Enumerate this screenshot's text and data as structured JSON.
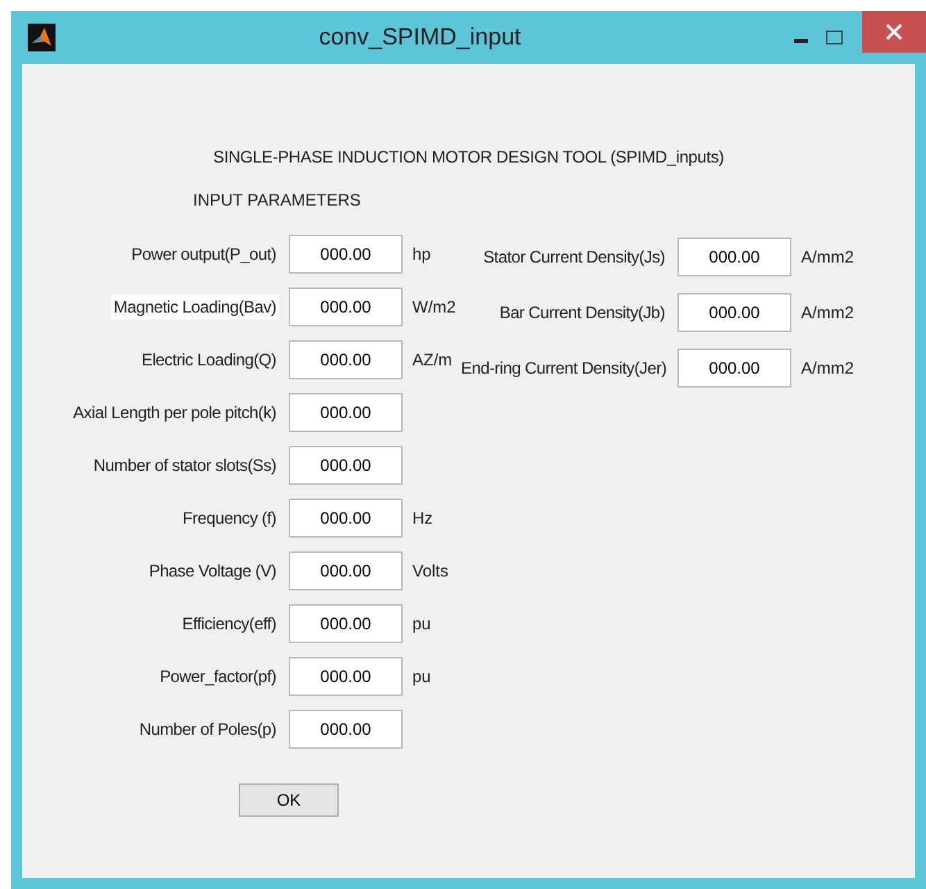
{
  "window": {
    "title": "conv_SPIMD_input"
  },
  "heading": "SINGLE-PHASE INDUCTION MOTOR DESIGN TOOL (SPIMD_inputs)",
  "section_label": "INPUT PARAMETERS",
  "left_fields": [
    {
      "label": "Power output(P_out)",
      "value": "000.00",
      "unit": "hp",
      "highlighted": false
    },
    {
      "label": "Magnetic Loading(Bav)",
      "value": "000.00",
      "unit": "W/m2",
      "highlighted": true
    },
    {
      "label": "Electric Loading(Q)",
      "value": "000.00",
      "unit": "AZ/m",
      "highlighted": false
    },
    {
      "label": "Axial Length per pole pitch(k)",
      "value": "000.00",
      "highlighted": false
    },
    {
      "label": "Number of stator slots(Ss)",
      "value": "000.00",
      "highlighted": false
    },
    {
      "label": "Frequency (f)",
      "value": "000.00",
      "unit": "Hz",
      "highlighted": false
    },
    {
      "label": "Phase Voltage (V)",
      "value": "000.00",
      "unit": "Volts",
      "highlighted": false
    },
    {
      "label": "Efficiency(eff)",
      "value": "000.00",
      "unit": "pu",
      "highlighted": false
    },
    {
      "label": "Power_factor(pf)",
      "value": "000.00",
      "unit": "pu",
      "highlighted": false
    },
    {
      "label": "Number of Poles(p)",
      "value": "000.00",
      "highlighted": false
    }
  ],
  "right_fields": [
    {
      "label": "Stator Current Density(Js)",
      "value": "000.00",
      "unit": "A/mm2"
    },
    {
      "label": "Bar Current Density(Jb)",
      "value": "000.00",
      "unit": "A/mm2"
    },
    {
      "label": "End-ring Current Density(Jer)",
      "value": "000.00",
      "unit": "A/mm2"
    }
  ],
  "buttons": [
    "OK"
  ]
}
